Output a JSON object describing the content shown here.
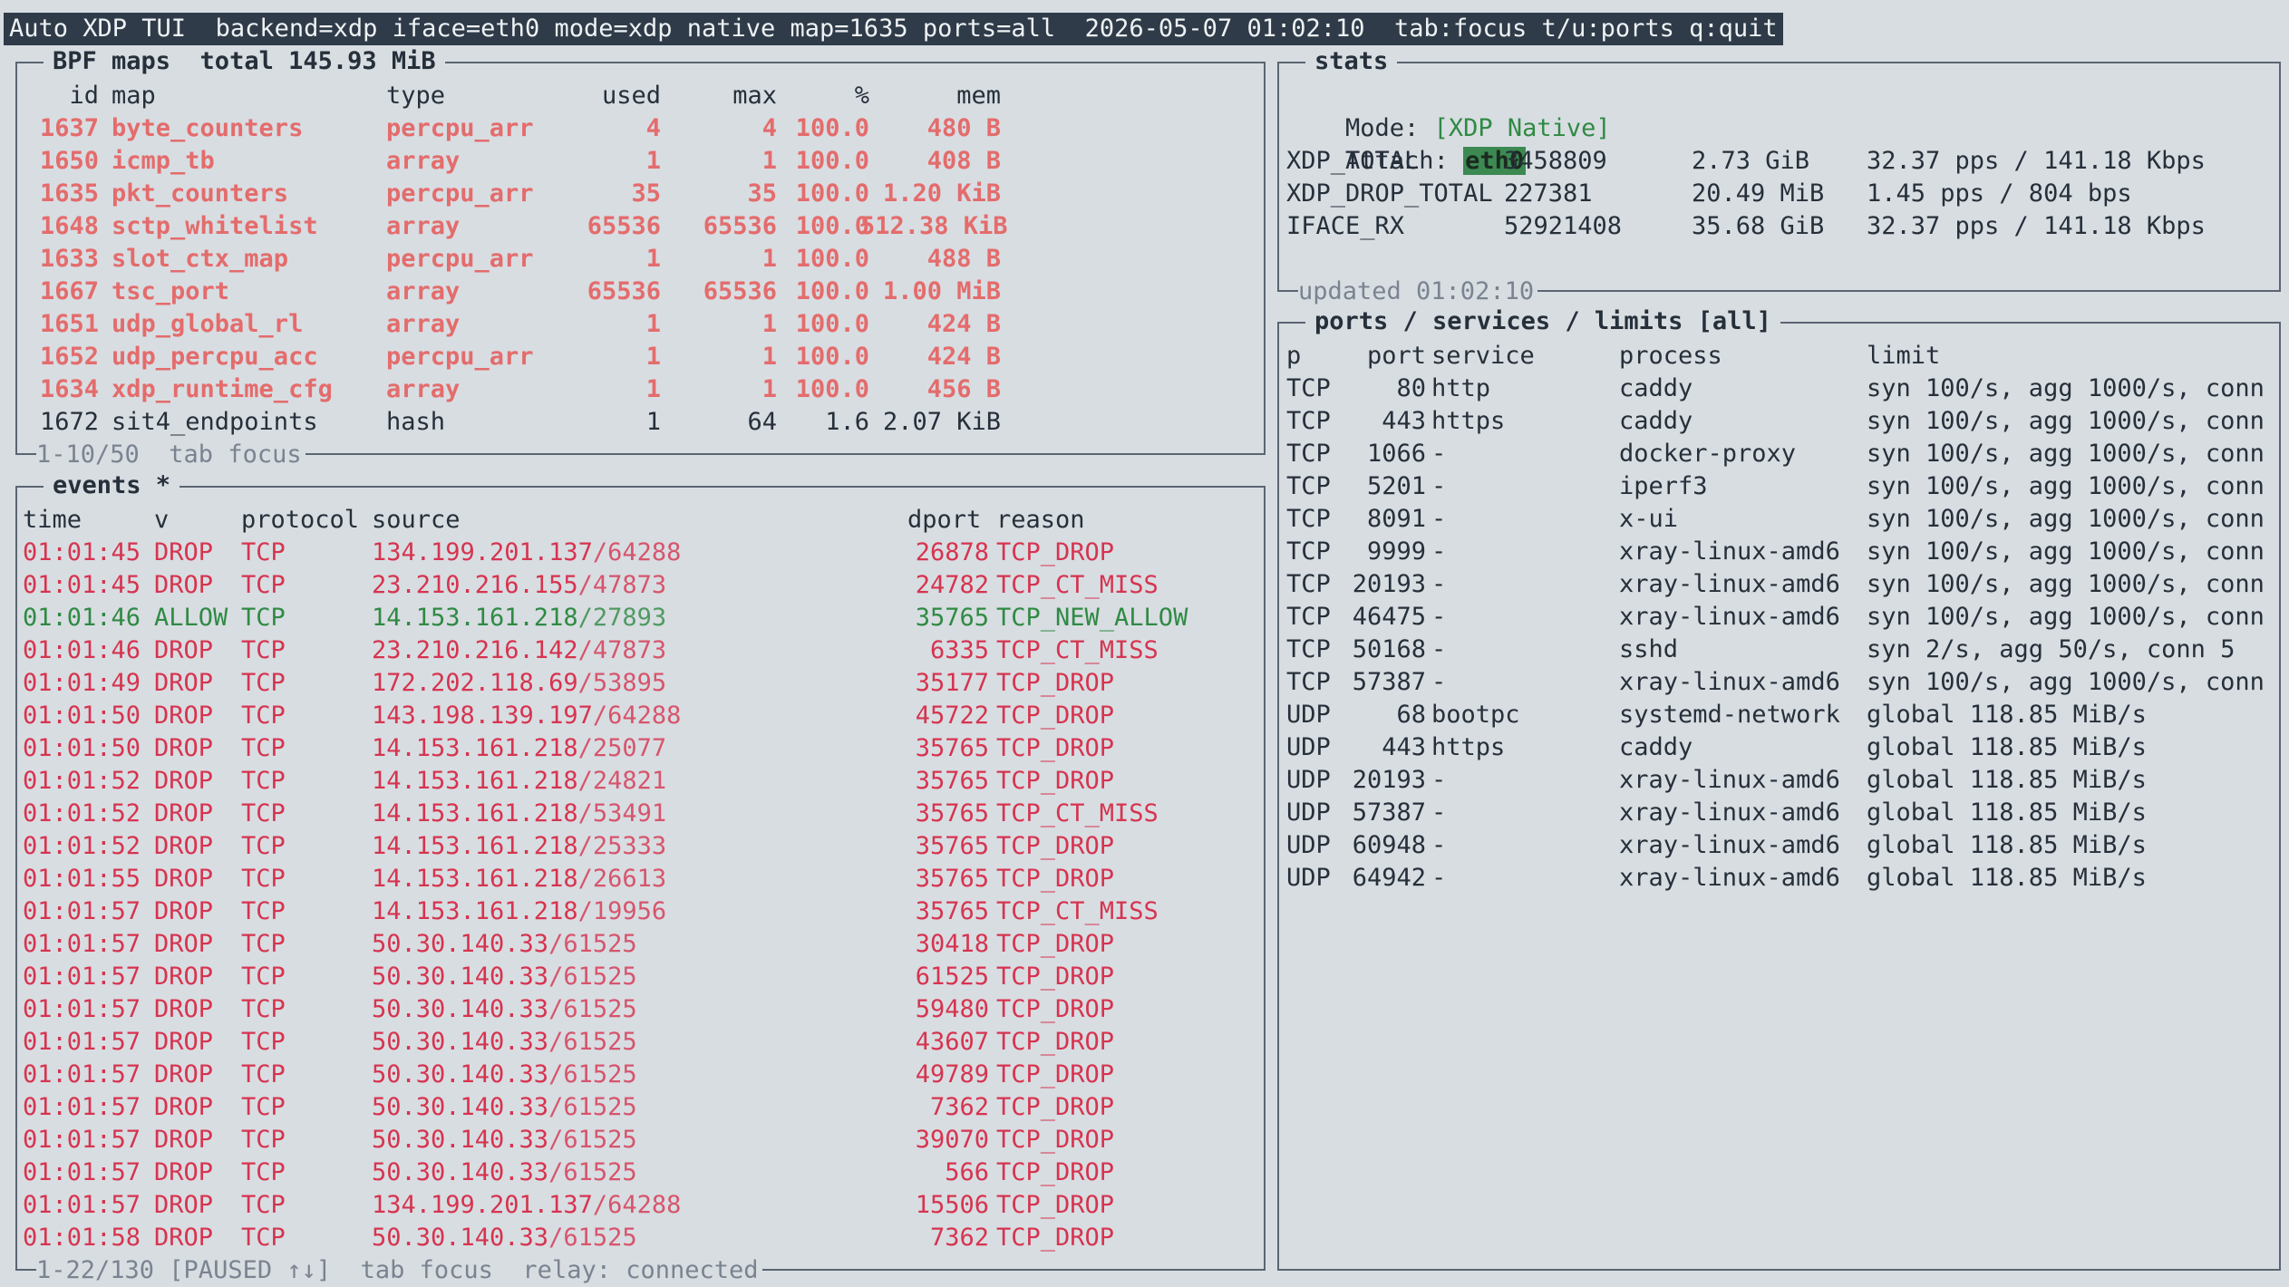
{
  "title_bar": "Auto XDP TUI  backend=xdp iface=eth0 mode=xdp native map=1635 ports=all  2026-05-07 01:02:10  tab:focus t/u:ports q:quit",
  "maps": {
    "title": "BPF maps  total 145.93 MiB",
    "headers": {
      "id": "id",
      "map": "map",
      "type": "type",
      "used": "used",
      "max": "max",
      "pct": "%",
      "mem": "mem"
    },
    "rows": [
      {
        "id": "1637",
        "map": "byte_counters",
        "type": "percpu_arr",
        "used": "4",
        "max": "4",
        "pct": "100.0",
        "mem": "480 B",
        "hot": true
      },
      {
        "id": "1650",
        "map": "icmp_tb",
        "type": "array",
        "used": "1",
        "max": "1",
        "pct": "100.0",
        "mem": "408 B",
        "hot": true
      },
      {
        "id": "1635",
        "map": "pkt_counters",
        "type": "percpu_arr",
        "used": "35",
        "max": "35",
        "pct": "100.0",
        "mem": "1.20 KiB",
        "hot": true
      },
      {
        "id": "1648",
        "map": "sctp_whitelist",
        "type": "array",
        "used": "65536",
        "max": "65536",
        "pct": "100.0",
        "mem": "512.38 KiB",
        "hot": true
      },
      {
        "id": "1633",
        "map": "slot_ctx_map",
        "type": "percpu_arr",
        "used": "1",
        "max": "1",
        "pct": "100.0",
        "mem": "488 B",
        "hot": true
      },
      {
        "id": "1667",
        "map": "tsc_port",
        "type": "array",
        "used": "65536",
        "max": "65536",
        "pct": "100.0",
        "mem": "1.00 MiB",
        "hot": true
      },
      {
        "id": "1651",
        "map": "udp_global_rl",
        "type": "array",
        "used": "1",
        "max": "1",
        "pct": "100.0",
        "mem": "424 B",
        "hot": true
      },
      {
        "id": "1652",
        "map": "udp_percpu_acc",
        "type": "percpu_arr",
        "used": "1",
        "max": "1",
        "pct": "100.0",
        "mem": "424 B",
        "hot": true
      },
      {
        "id": "1634",
        "map": "xdp_runtime_cfg",
        "type": "array",
        "used": "1",
        "max": "1",
        "pct": "100.0",
        "mem": "456 B",
        "hot": true
      },
      {
        "id": "1672",
        "map": "sit4_endpoints",
        "type": "hash",
        "used": "1",
        "max": "64",
        "pct": "1.6",
        "mem": "2.07 KiB",
        "hot": false
      }
    ],
    "footer": "1-10/50  tab focus"
  },
  "events": {
    "title": "events *",
    "headers": {
      "time": "time",
      "v": "v",
      "protocol": "protocol",
      "source": "source",
      "dport": "dport",
      "reason": "reason"
    },
    "rows": [
      {
        "time": "01:01:45",
        "v": "DROP",
        "protocol": "TCP",
        "ip": "134.199.201.137",
        "port": "/64288",
        "dport": "26878",
        "reason": "TCP_DROP"
      },
      {
        "time": "01:01:45",
        "v": "DROP",
        "protocol": "TCP",
        "ip": "23.210.216.155",
        "port": "/47873",
        "dport": "24782",
        "reason": "TCP_CT_MISS"
      },
      {
        "time": "01:01:46",
        "v": "ALLOW",
        "protocol": "TCP",
        "ip": "14.153.161.218",
        "port": "/27893",
        "dport": "35765",
        "reason": "TCP_NEW_ALLOW"
      },
      {
        "time": "01:01:46",
        "v": "DROP",
        "protocol": "TCP",
        "ip": "23.210.216.142",
        "port": "/47873",
        "dport": "6335",
        "reason": "TCP_CT_MISS"
      },
      {
        "time": "01:01:49",
        "v": "DROP",
        "protocol": "TCP",
        "ip": "172.202.118.69",
        "port": "/53895",
        "dport": "35177",
        "reason": "TCP_DROP"
      },
      {
        "time": "01:01:50",
        "v": "DROP",
        "protocol": "TCP",
        "ip": "143.198.139.197",
        "port": "/64288",
        "dport": "45722",
        "reason": "TCP_DROP"
      },
      {
        "time": "01:01:50",
        "v": "DROP",
        "protocol": "TCP",
        "ip": "14.153.161.218",
        "port": "/25077",
        "dport": "35765",
        "reason": "TCP_DROP"
      },
      {
        "time": "01:01:52",
        "v": "DROP",
        "protocol": "TCP",
        "ip": "14.153.161.218",
        "port": "/24821",
        "dport": "35765",
        "reason": "TCP_DROP"
      },
      {
        "time": "01:01:52",
        "v": "DROP",
        "protocol": "TCP",
        "ip": "14.153.161.218",
        "port": "/53491",
        "dport": "35765",
        "reason": "TCP_CT_MISS"
      },
      {
        "time": "01:01:52",
        "v": "DROP",
        "protocol": "TCP",
        "ip": "14.153.161.218",
        "port": "/25333",
        "dport": "35765",
        "reason": "TCP_DROP"
      },
      {
        "time": "01:01:55",
        "v": "DROP",
        "protocol": "TCP",
        "ip": "14.153.161.218",
        "port": "/26613",
        "dport": "35765",
        "reason": "TCP_DROP"
      },
      {
        "time": "01:01:57",
        "v": "DROP",
        "protocol": "TCP",
        "ip": "14.153.161.218",
        "port": "/19956",
        "dport": "35765",
        "reason": "TCP_CT_MISS"
      },
      {
        "time": "01:01:57",
        "v": "DROP",
        "protocol": "TCP",
        "ip": "50.30.140.33",
        "port": "/61525",
        "dport": "30418",
        "reason": "TCP_DROP"
      },
      {
        "time": "01:01:57",
        "v": "DROP",
        "protocol": "TCP",
        "ip": "50.30.140.33",
        "port": "/61525",
        "dport": "61525",
        "reason": "TCP_DROP"
      },
      {
        "time": "01:01:57",
        "v": "DROP",
        "protocol": "TCP",
        "ip": "50.30.140.33",
        "port": "/61525",
        "dport": "59480",
        "reason": "TCP_DROP"
      },
      {
        "time": "01:01:57",
        "v": "DROP",
        "protocol": "TCP",
        "ip": "50.30.140.33",
        "port": "/61525",
        "dport": "43607",
        "reason": "TCP_DROP"
      },
      {
        "time": "01:01:57",
        "v": "DROP",
        "protocol": "TCP",
        "ip": "50.30.140.33",
        "port": "/61525",
        "dport": "49789",
        "reason": "TCP_DROP"
      },
      {
        "time": "01:01:57",
        "v": "DROP",
        "protocol": "TCP",
        "ip": "50.30.140.33",
        "port": "/61525",
        "dport": "7362",
        "reason": "TCP_DROP"
      },
      {
        "time": "01:01:57",
        "v": "DROP",
        "protocol": "TCP",
        "ip": "50.30.140.33",
        "port": "/61525",
        "dport": "39070",
        "reason": "TCP_DROP"
      },
      {
        "time": "01:01:57",
        "v": "DROP",
        "protocol": "TCP",
        "ip": "50.30.140.33",
        "port": "/61525",
        "dport": "566",
        "reason": "TCP_DROP"
      },
      {
        "time": "01:01:57",
        "v": "DROP",
        "protocol": "TCP",
        "ip": "134.199.201.137",
        "port": "/64288",
        "dport": "15506",
        "reason": "TCP_DROP"
      },
      {
        "time": "01:01:58",
        "v": "DROP",
        "protocol": "TCP",
        "ip": "50.30.140.33",
        "port": "/61525",
        "dport": "7362",
        "reason": "TCP_DROP"
      }
    ],
    "footer": "1-22/130 [PAUSED ↑↓]  tab focus  relay: connected"
  },
  "stats": {
    "title": "stats",
    "mode_label": "Mode: ",
    "mode_value": "[XDP Native]",
    "attach_label": "Attach: ",
    "attach_value": "eth0",
    "rows": [
      {
        "name": "XDP_TOTAL",
        "count": "3458809",
        "size": "2.73 GiB",
        "rate": "32.37 pps / 141.18 Kbps"
      },
      {
        "name": "XDP_DROP_TOTAL",
        "count": "227381",
        "size": "20.49 MiB",
        "rate": "1.45 pps / 804 bps"
      },
      {
        "name": "IFACE_RX",
        "count": "52921408",
        "size": "35.68 GiB",
        "rate": "32.37 pps / 141.18 Kbps"
      }
    ],
    "footer": "updated 01:02:10"
  },
  "ports": {
    "title": "ports / services / limits [all]",
    "headers": {
      "p": "p",
      "port": "port",
      "service": "service",
      "process": "process",
      "limit": "limit"
    },
    "rows": [
      {
        "p": "TCP",
        "port": "80",
        "service": "http",
        "process": "caddy",
        "limit": "syn 100/s, agg 1000/s, conn"
      },
      {
        "p": "TCP",
        "port": "443",
        "service": "https",
        "process": "caddy",
        "limit": "syn 100/s, agg 1000/s, conn"
      },
      {
        "p": "TCP",
        "port": "1066",
        "service": "-",
        "process": "docker-proxy",
        "limit": "syn 100/s, agg 1000/s, conn"
      },
      {
        "p": "TCP",
        "port": "5201",
        "service": "-",
        "process": "iperf3",
        "limit": "syn 100/s, agg 1000/s, conn"
      },
      {
        "p": "TCP",
        "port": "8091",
        "service": "-",
        "process": "x-ui",
        "limit": "syn 100/s, agg 1000/s, conn"
      },
      {
        "p": "TCP",
        "port": "9999",
        "service": "-",
        "process": "xray-linux-amd6",
        "limit": "syn 100/s, agg 1000/s, conn"
      },
      {
        "p": "TCP",
        "port": "20193",
        "service": "-",
        "process": "xray-linux-amd6",
        "limit": "syn 100/s, agg 1000/s, conn"
      },
      {
        "p": "TCP",
        "port": "46475",
        "service": "-",
        "process": "xray-linux-amd6",
        "limit": "syn 100/s, agg 1000/s, conn"
      },
      {
        "p": "TCP",
        "port": "50168",
        "service": "-",
        "process": "sshd",
        "limit": "syn 2/s, agg 50/s, conn 5"
      },
      {
        "p": "TCP",
        "port": "57387",
        "service": "-",
        "process": "xray-linux-amd6",
        "limit": "syn 100/s, agg 1000/s, conn"
      },
      {
        "p": "UDP",
        "port": "68",
        "service": "bootpc",
        "process": "systemd-network",
        "limit": "global 118.85 MiB/s"
      },
      {
        "p": "UDP",
        "port": "443",
        "service": "https",
        "process": "caddy",
        "limit": "global 118.85 MiB/s"
      },
      {
        "p": "UDP",
        "port": "20193",
        "service": "-",
        "process": "xray-linux-amd6",
        "limit": "global 118.85 MiB/s"
      },
      {
        "p": "UDP",
        "port": "57387",
        "service": "-",
        "process": "xray-linux-amd6",
        "limit": "global 118.85 MiB/s"
      },
      {
        "p": "UDP",
        "port": "60948",
        "service": "-",
        "process": "xray-linux-amd6",
        "limit": "global 118.85 MiB/s"
      },
      {
        "p": "UDP",
        "port": "64942",
        "service": "-",
        "process": "xray-linux-amd6",
        "limit": "global 118.85 MiB/s"
      }
    ]
  },
  "colors": {
    "drop": "#d6344f",
    "allow": "#2f8a43",
    "hot": "#e46c6c",
    "background": "#d8dde2",
    "title_bar": "#2f3b48"
  }
}
